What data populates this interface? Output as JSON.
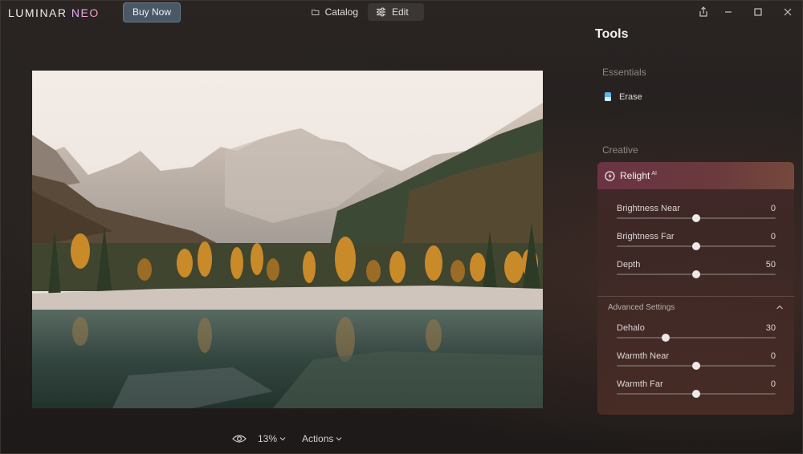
{
  "app": {
    "logo_main": "LUMINAR ",
    "logo_accent": "NEO",
    "buy_label": "Buy Now"
  },
  "modes": {
    "catalog_label": "Catalog",
    "edit_label": "Edit"
  },
  "bottom": {
    "zoom": "13%",
    "actions_label": "Actions"
  },
  "panel": {
    "title": "Tools",
    "essentials_label": "Essentials",
    "erase_label": "Erase",
    "creative_label": "Creative",
    "relight": {
      "title": "Relight",
      "ai_tag": "AI",
      "sliders": [
        {
          "label": "Brightness Near",
          "value": "0",
          "fraction": 0.5
        },
        {
          "label": "Brightness Far",
          "value": "0",
          "fraction": 0.5
        },
        {
          "label": "Depth",
          "value": "50",
          "fraction": 0.5
        }
      ],
      "advanced_label": "Advanced Settings",
      "advanced_sliders": [
        {
          "label": "Dehalo",
          "value": "30",
          "fraction": 0.31
        },
        {
          "label": "Warmth Near",
          "value": "0",
          "fraction": 0.5
        },
        {
          "label": "Warmth Far",
          "value": "0",
          "fraction": 0.5
        }
      ]
    }
  },
  "colors": {
    "accent_relight": "#6b3344",
    "buy_button": "#4a5866"
  },
  "icons": {
    "catalog": "folder-icon",
    "edit": "sliders-icon",
    "share": "share-icon",
    "minimize": "minimize-icon",
    "maximize": "maximize-icon",
    "close": "close-icon",
    "preview": "eye-icon",
    "erase": "eraser-icon",
    "relight": "relight-icon"
  }
}
